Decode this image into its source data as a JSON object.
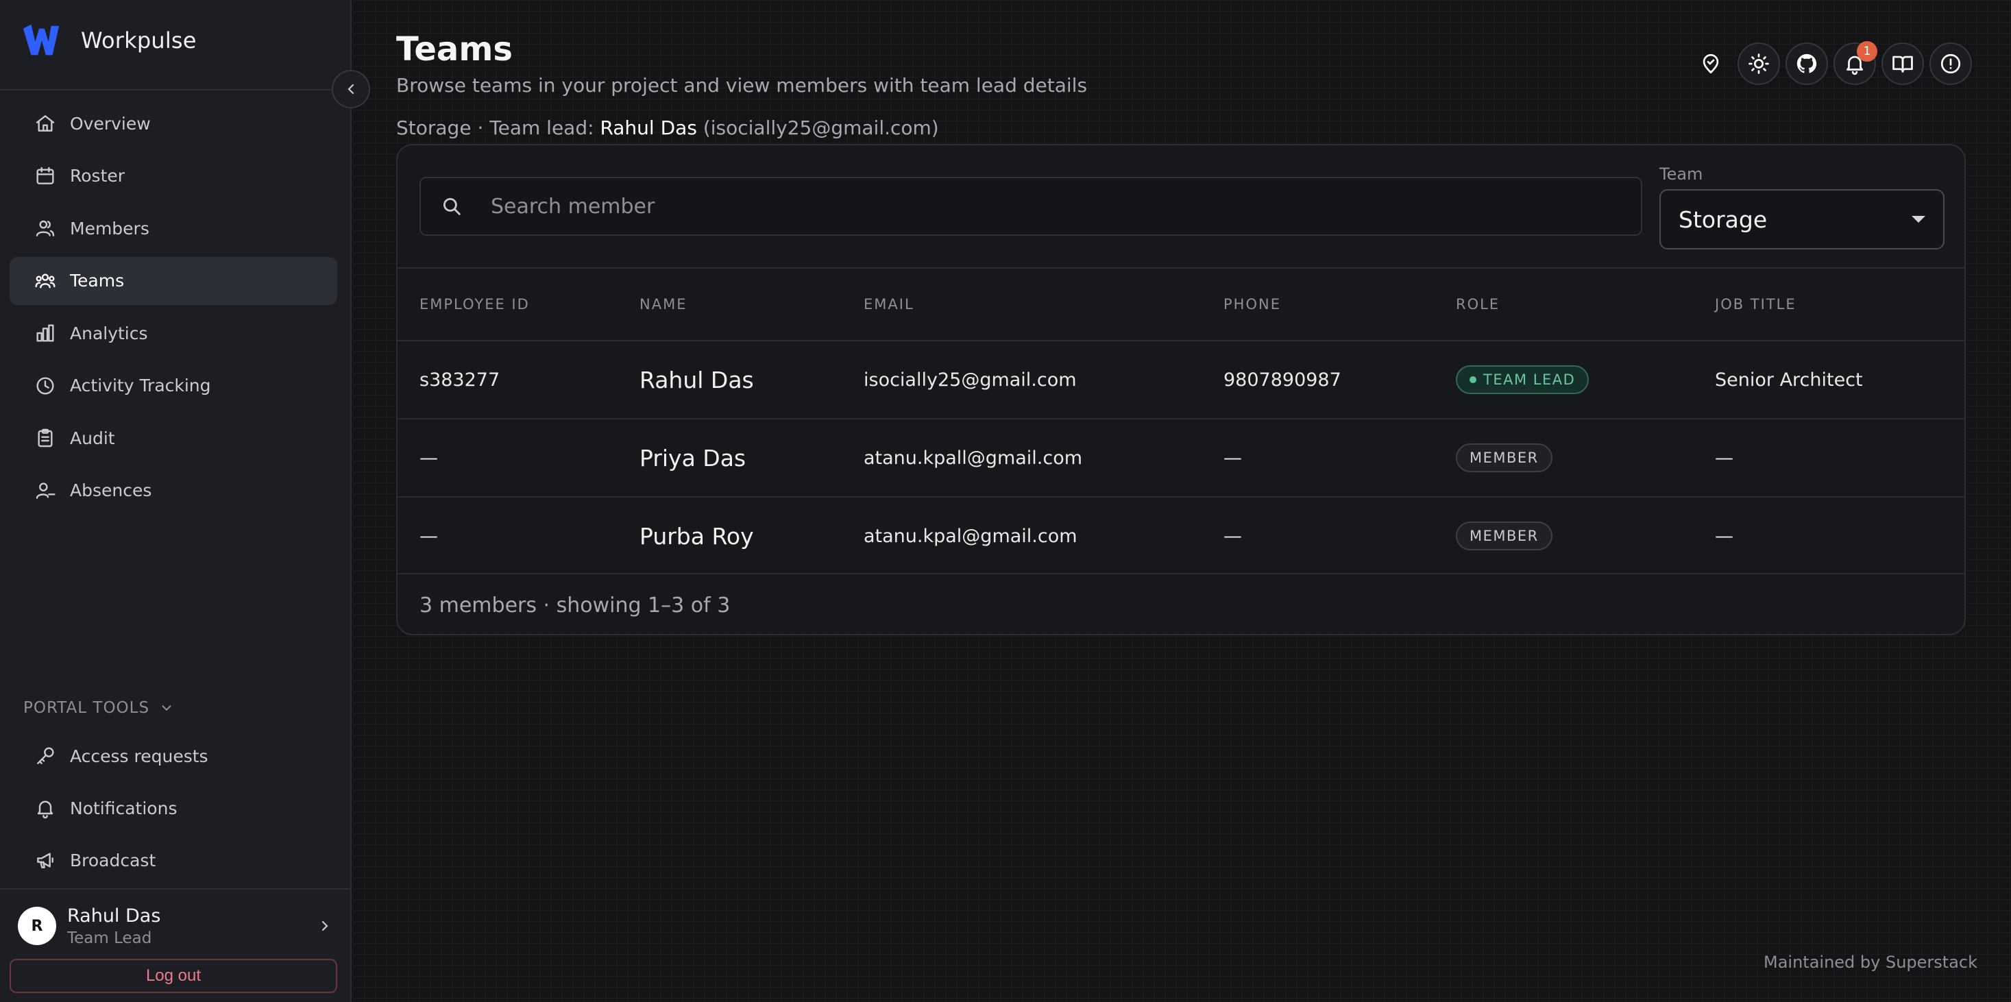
{
  "brand": {
    "name": "Workpulse",
    "accent": "#2f5fff"
  },
  "nav": [
    {
      "label": "Overview",
      "icon": "home-icon"
    },
    {
      "label": "Roster",
      "icon": "calendar-icon"
    },
    {
      "label": "Members",
      "icon": "users-icon"
    },
    {
      "label": "Teams",
      "icon": "team-icon",
      "active": true
    },
    {
      "label": "Analytics",
      "icon": "bar-chart-icon"
    },
    {
      "label": "Activity Tracking",
      "icon": "clock-icon"
    },
    {
      "label": "Audit",
      "icon": "clipboard-icon"
    },
    {
      "label": "Absences",
      "icon": "user-minus-icon"
    }
  ],
  "portal_tools": {
    "title": "PORTAL TOOLS",
    "items": [
      {
        "label": "Access requests",
        "icon": "key-icon"
      },
      {
        "label": "Notifications",
        "icon": "bell-icon"
      },
      {
        "label": "Broadcast",
        "icon": "megaphone-icon"
      }
    ]
  },
  "user": {
    "initial": "R",
    "name": "Rahul Das",
    "role": "Team Lead",
    "logout_label": "Log out"
  },
  "header": {
    "title": "Teams",
    "subtitle": "Browse teams in your project and view members with team lead details",
    "lead_prefix": "Storage · Team lead: ",
    "lead_name": "Rahul Das",
    "lead_email": "(isocially25@gmail.com)",
    "notification_count": "1"
  },
  "filters": {
    "search_placeholder": "Search member",
    "team_label": "Team",
    "team_value": "Storage"
  },
  "table": {
    "columns": [
      "EMPLOYEE ID",
      "NAME",
      "EMAIL",
      "PHONE",
      "ROLE",
      "JOB TITLE"
    ],
    "rows": [
      {
        "employee_id": "s383277",
        "name": "Rahul Das",
        "email": "isocially25@gmail.com",
        "phone": "9807890987",
        "role": "TEAM LEAD",
        "job_title": "Senior Architect"
      },
      {
        "employee_id": "—",
        "name": "Priya Das",
        "email": "atanu.kpall@gmail.com",
        "phone": "—",
        "role": "MEMBER",
        "job_title": "—"
      },
      {
        "employee_id": "—",
        "name": "Purba Roy",
        "email": "atanu.kpal@gmail.com",
        "phone": "—",
        "role": "MEMBER",
        "job_title": "—"
      }
    ],
    "summary": "3 members · showing 1–3 of 3"
  },
  "footer": {
    "maintained": "Maintained by Superstack"
  }
}
